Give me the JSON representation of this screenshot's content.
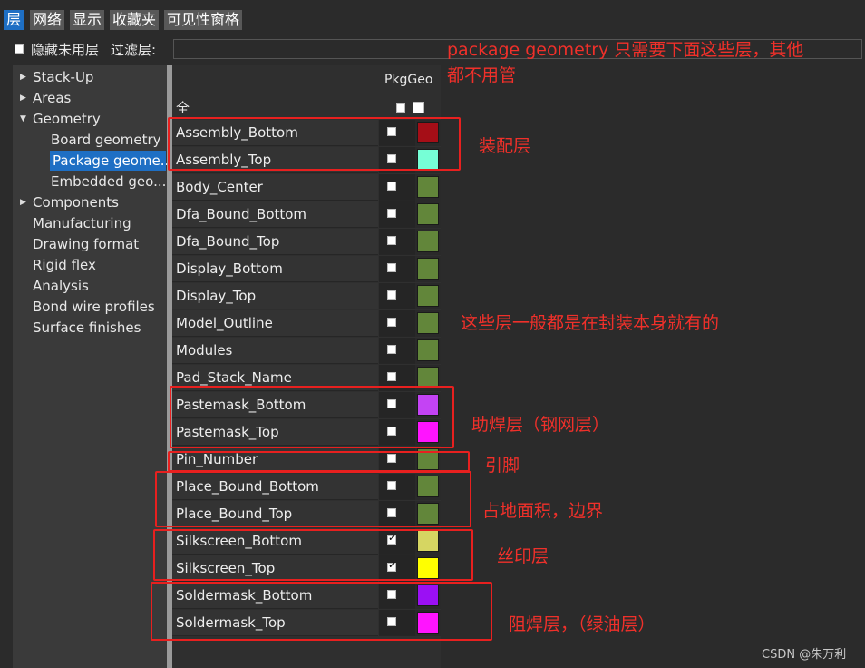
{
  "tabs": [
    "层",
    "网络",
    "显示",
    "收藏夹",
    "可见性窗格"
  ],
  "hide_unused_label": "隐藏未用层",
  "filter_label": "过滤层:",
  "tree": [
    {
      "label": "Stack-Up",
      "arrow": "▶"
    },
    {
      "label": "Areas",
      "arrow": "▶"
    },
    {
      "label": "Geometry",
      "arrow": "▼"
    },
    {
      "label": "Board geometry"
    },
    {
      "label": "Package geome..."
    },
    {
      "label": "Embedded geo..."
    },
    {
      "label": "Components",
      "arrow": "▶"
    },
    {
      "label": "Manufacturing"
    },
    {
      "label": "Drawing format"
    },
    {
      "label": "Rigid flex"
    },
    {
      "label": "Analysis"
    },
    {
      "label": "Bond wire profiles"
    },
    {
      "label": "Surface finishes"
    }
  ],
  "column_header": "PkgGeo",
  "all_label": "全",
  "layers": [
    {
      "name": "Assembly_Bottom",
      "checked": false,
      "color": "#a50e17"
    },
    {
      "name": "Assembly_Top",
      "checked": false,
      "color": "#76ffd6"
    },
    {
      "name": "Body_Center",
      "checked": false,
      "color": "#62863a"
    },
    {
      "name": "Dfa_Bound_Bottom",
      "checked": false,
      "color": "#62863a"
    },
    {
      "name": "Dfa_Bound_Top",
      "checked": false,
      "color": "#62863a"
    },
    {
      "name": "Display_Bottom",
      "checked": false,
      "color": "#62863a"
    },
    {
      "name": "Display_Top",
      "checked": false,
      "color": "#62863a"
    },
    {
      "name": "Model_Outline",
      "checked": false,
      "color": "#62863a"
    },
    {
      "name": "Modules",
      "checked": false,
      "color": "#62863a"
    },
    {
      "name": "Pad_Stack_Name",
      "checked": false,
      "color": "#62863a"
    },
    {
      "name": "Pastemask_Bottom",
      "checked": false,
      "color": "#c443f4"
    },
    {
      "name": "Pastemask_Top",
      "checked": false,
      "color": "#ff14ff"
    },
    {
      "name": "Pin_Number",
      "checked": false,
      "color": "#62863a"
    },
    {
      "name": "Place_Bound_Bottom",
      "checked": false,
      "color": "#62863a"
    },
    {
      "name": "Place_Bound_Top",
      "checked": false,
      "color": "#62863a"
    },
    {
      "name": "Silkscreen_Bottom",
      "checked": true,
      "color": "#d6d662"
    },
    {
      "name": "Silkscreen_Top",
      "checked": true,
      "color": "#ffff00"
    },
    {
      "name": "Soldermask_Bottom",
      "checked": false,
      "color": "#9b10f4"
    },
    {
      "name": "Soldermask_Top",
      "checked": false,
      "color": "#ff14ff"
    }
  ],
  "annotations": {
    "top_note_line1": "package geometry 只需要下面这些层，其他",
    "top_note_line2": "都不用管",
    "assembly": "装配层",
    "common": "这些层一般都是在封装本身就有的",
    "pastemask": "助焊层（钢网层）",
    "pin": "引脚",
    "place_bound": "占地面积，边界",
    "silkscreen": "丝印层",
    "soldermask": "阻焊层，（绿油层）"
  },
  "watermark": "CSDN @朱万利",
  "colors": {
    "accent": "#1e6fc4",
    "annotation": "#e8201f"
  }
}
